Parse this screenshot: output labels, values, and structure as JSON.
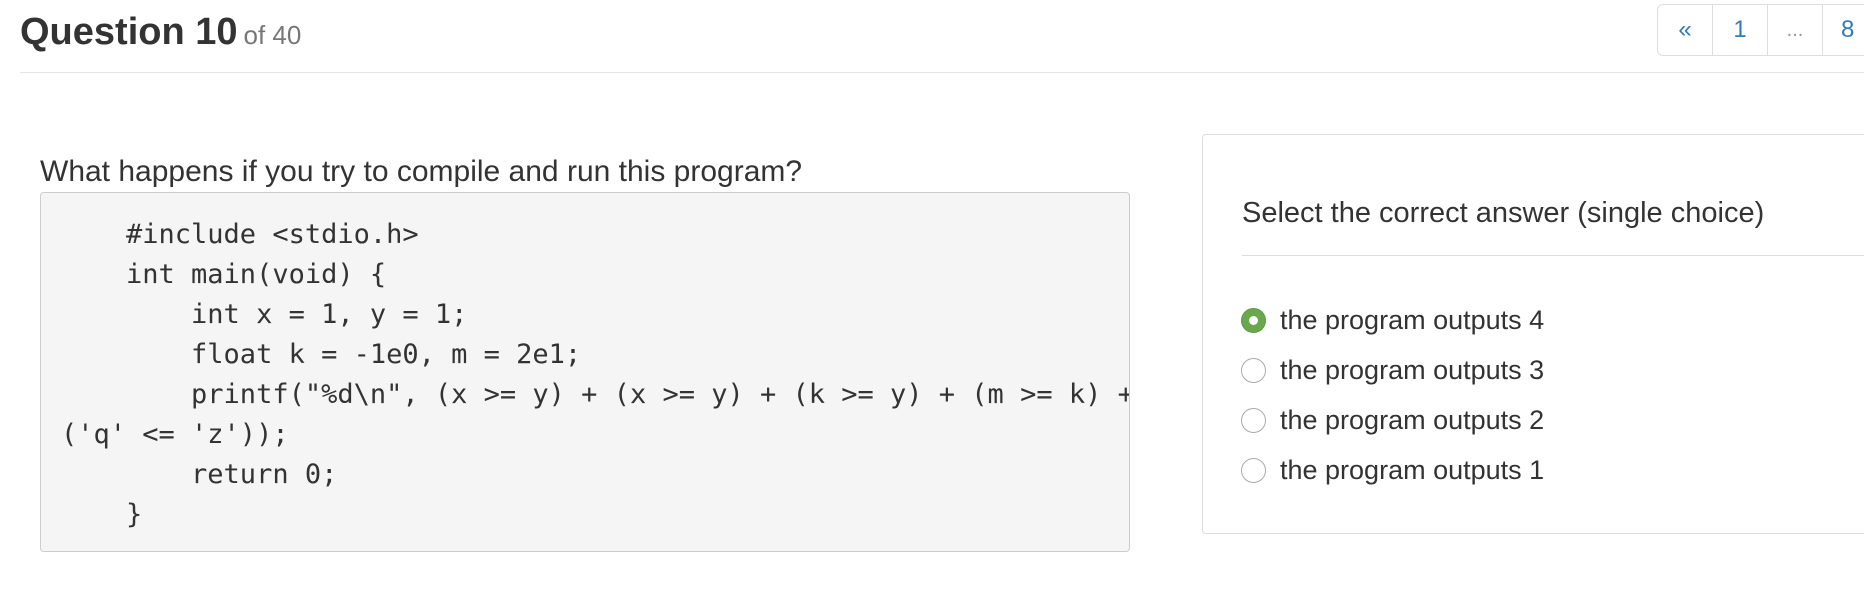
{
  "header": {
    "title": "Question 10",
    "subtitle": "of 40"
  },
  "pagination": {
    "prev": "«",
    "first": "1",
    "ellipsis": "...",
    "next_partial": "8"
  },
  "question": {
    "text": "What happens if you try to compile and run this program?",
    "code": "    #include <stdio.h>\n    int main(void) {\n        int x = 1, y = 1;\n        float k = -1e0, m = 2e1;\n        printf(\"%d\\n\", (x >= y) + (x >= y) + (k >= y) + (m >= k) +\n('q' <= 'z'));\n        return 0;\n    }"
  },
  "answers": {
    "heading": "Select the correct answer (single choice)",
    "options": [
      {
        "label": "the program outputs 4",
        "selected": true
      },
      {
        "label": "the program outputs 3",
        "selected": false
      },
      {
        "label": "the program outputs 2",
        "selected": false
      },
      {
        "label": "the program outputs 1",
        "selected": false
      }
    ]
  },
  "colors": {
    "accent": "#337ab7",
    "selected_radio": "#6aa84f"
  }
}
